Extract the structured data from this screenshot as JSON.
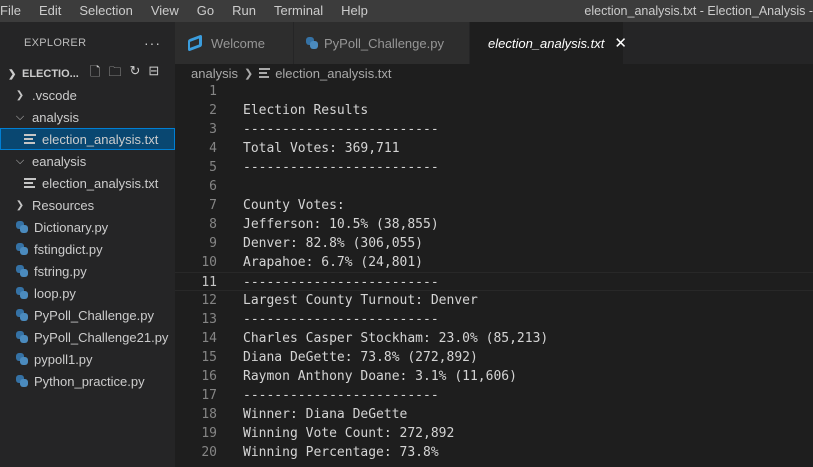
{
  "menu": [
    "File",
    "Edit",
    "Selection",
    "View",
    "Go",
    "Run",
    "Terminal",
    "Help"
  ],
  "window_title": "election_analysis.txt - Election_Analysis -",
  "explorer": {
    "title": "EXPLORER",
    "more": "···",
    "folder_name": "ELECTIO...",
    "items": [
      {
        "label": ".vscode",
        "type": "folder",
        "open": false,
        "indent": 1
      },
      {
        "label": "analysis",
        "type": "folder",
        "open": true,
        "indent": 1
      },
      {
        "label": "election_analysis.txt",
        "type": "txt",
        "indent": 2,
        "selected": true
      },
      {
        "label": "eanalysis",
        "type": "folder",
        "open": true,
        "indent": 1
      },
      {
        "label": "election_analysis.txt",
        "type": "txt",
        "indent": 2
      },
      {
        "label": "Resources",
        "type": "folder",
        "open": false,
        "indent": 1
      },
      {
        "label": "Dictionary.py",
        "type": "py",
        "indent": 1
      },
      {
        "label": "fstingdict.py",
        "type": "py",
        "indent": 1
      },
      {
        "label": "fstring.py",
        "type": "py",
        "indent": 1
      },
      {
        "label": "loop.py",
        "type": "py",
        "indent": 1
      },
      {
        "label": "PyPoll_Challenge.py",
        "type": "py",
        "indent": 1
      },
      {
        "label": "PyPoll_Challenge21.py",
        "type": "py",
        "indent": 1
      },
      {
        "label": "pypoll1.py",
        "type": "py",
        "indent": 1
      },
      {
        "label": "Python_practice.py",
        "type": "py",
        "indent": 1
      }
    ]
  },
  "tabs": [
    {
      "label": "Welcome",
      "icon": "vscode-icon"
    },
    {
      "label": "PyPoll_Challenge.py",
      "icon": "python-icon"
    },
    {
      "label": "election_analysis.txt",
      "icon": "text-file-icon",
      "active": true
    }
  ],
  "breadcrumb": {
    "folder": "analysis",
    "file": "election_analysis.txt"
  },
  "editor": {
    "current_line": 11,
    "lines": [
      "",
      "Election Results",
      "-------------------------",
      "Total Votes: 369,711",
      "-------------------------",
      "",
      "County Votes:",
      "Jefferson: 10.5% (38,855)",
      "Denver: 82.8% (306,055)",
      "Arapahoe: 6.7% (24,801)",
      "-------------------------",
      "Largest County Turnout: Denver",
      "-------------------------",
      "Charles Casper Stockham: 23.0% (85,213)",
      "Diana DeGette: 73.8% (272,892)",
      "Raymon Anthony Doane: 3.1% (11,606)",
      "-------------------------",
      "Winner: Diana DeGette",
      "Winning Vote Count: 272,892",
      "Winning Percentage: 73.8%"
    ]
  },
  "colors": {
    "background": "#1e1e1e",
    "sidebar": "#252526",
    "menubar": "#3c3c3c",
    "selection": "#094771",
    "python": "#4b8bbe",
    "vscode_blue": "#3b9ddd"
  }
}
